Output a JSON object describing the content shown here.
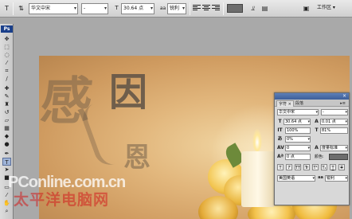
{
  "options_bar": {
    "font_family": "华文中宋",
    "font_style": "-",
    "font_size": "30.64 点",
    "antialias": "锐利",
    "workspace_label": "工作区",
    "text_tool_glyph": "T",
    "colors": {
      "swatch": "#6d6d6d"
    }
  },
  "toolbox": {
    "logo": "Ps",
    "tools": [
      "move-icon",
      "marquee-icon",
      "lasso-icon",
      "magic-wand-icon",
      "crop-icon",
      "slice-icon",
      "healing-icon",
      "brush-icon",
      "stamp-icon",
      "history-brush-icon",
      "eraser-icon",
      "gradient-icon",
      "blur-icon",
      "dodge-icon",
      "pen-icon",
      "type-icon",
      "path-select-icon",
      "shape-icon",
      "notes-icon",
      "eyedropper-icon",
      "hand-icon",
      "zoom-icon"
    ]
  },
  "document": {
    "chars": {
      "gan": "感",
      "yin": "因",
      "en": "恩"
    },
    "colors": {
      "background": "#d9a86b"
    }
  },
  "watermark": {
    "brand": "PConline.com.cn",
    "chinese": "太平洋电脑网"
  },
  "character_panel": {
    "tabs": [
      "字符",
      "段落"
    ],
    "font_family": "华文中宋",
    "font_style": "-",
    "font_size": "30.64 点",
    "leading": "0.01 点",
    "vertical_scale": "100%",
    "horizontal_scale": "81%",
    "tracking_ratio": "0%",
    "kerning": "0",
    "kerning_mode": "度量标准",
    "baseline_shift": "0 点",
    "color_label": "颜色:",
    "language": "美国英语",
    "antialias": "锐利",
    "style_buttons": [
      "T",
      "T",
      "TT",
      "Tr",
      "T¹",
      "T₁",
      "T",
      "T"
    ]
  }
}
